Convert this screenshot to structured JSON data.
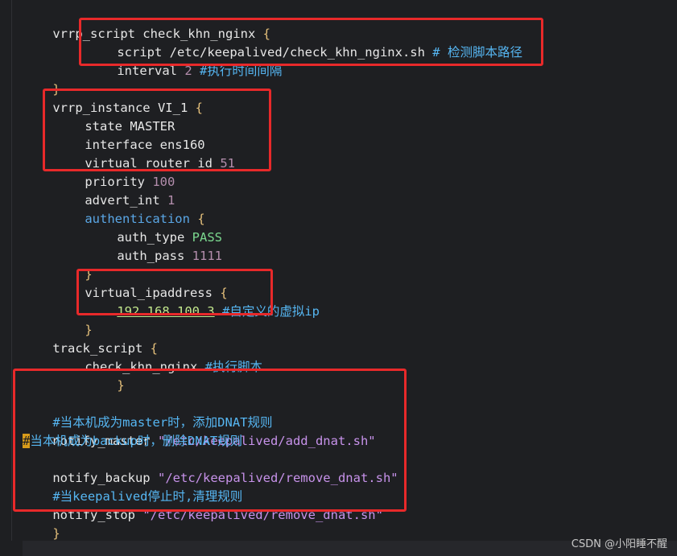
{
  "colors": {
    "background": "#1e1f22",
    "text": "#e6e6e6",
    "brace": "#e5c07b",
    "comment": "#56b6f2",
    "number": "#b48ead",
    "string": "#c792ea",
    "highlight_box": "#e8292a"
  },
  "lines": {
    "l1_key": "vrrp_script check_khn_nginx",
    "l2_key": "script",
    "l2_val": "/etc/keepalived/check_khn_nginx.sh",
    "l2_comment": "# 检测脚本路径",
    "l3_key": "interval",
    "l3_num": "2",
    "l3_comment": "#执行时间间隔",
    "l4_close": "}",
    "l5_key": "vrrp_instance VI_1",
    "l6_key": "state MASTER",
    "l7_key": "interface ens160",
    "l8_key": "virtual_router_id",
    "l8_num": "51",
    "l9_key": "priority",
    "l9_num": "100",
    "l10_key": "advert_int",
    "l10_num": "1",
    "l11_key": "authentication",
    "l12_key": "auth_type",
    "l12_val": "PASS",
    "l13_key": "auth_pass",
    "l13_num": "1111",
    "l14_close": "}",
    "l15_key": "virtual_ipaddress",
    "l16_ip": "192.168.100.3",
    "l16_comment": "#自定义的虚拟ip",
    "l17_close": "}",
    "l18_key": "track_script",
    "l19_key": "check_khn_nginx",
    "l19_comment": "#执行脚本",
    "l20_close": "}",
    "l22_comment": "#当本机成为master时，添加DNAT规则",
    "l23_key": "notify_master",
    "l23_str": "\"/etc/keepalived/add_dnat.sh\"",
    "l24_cursor": "#",
    "l24_comment": "当本机成为backup时，删除DNAT规则",
    "l25_key": "notify_backup",
    "l25_str": "\"/etc/keepalived/remove_dnat.sh\"",
    "l26_comment": "#当keepalived停止时,清理规则",
    "l27_key": "notify_stop",
    "l27_str": "\"/etc/keepalived/remove_dnat.sh\"",
    "l28_close": "}",
    "open_brace": "{"
  },
  "watermark": "CSDN @小阳睡不醒"
}
